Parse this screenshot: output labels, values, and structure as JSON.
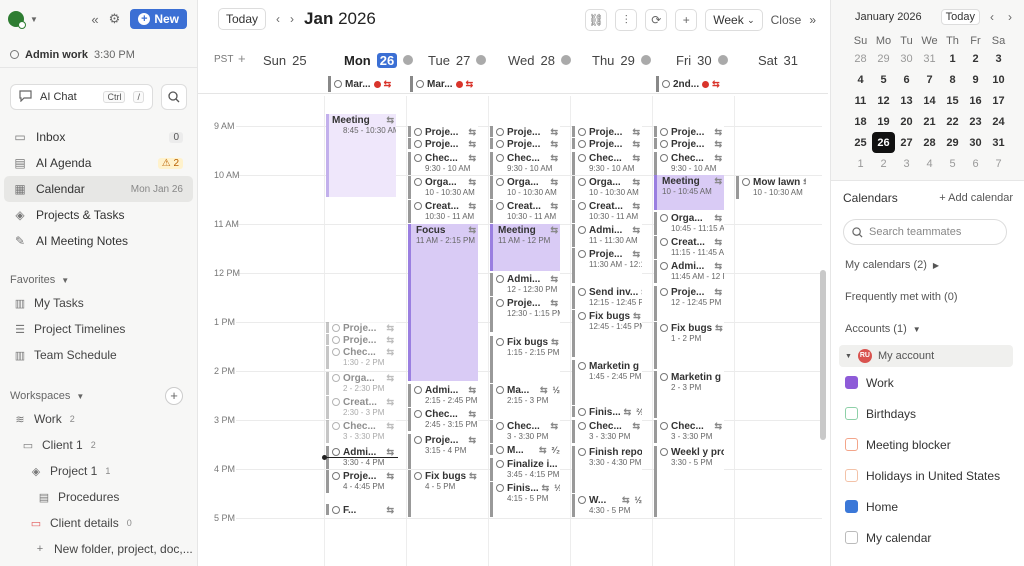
{
  "sidebar": {
    "new_label": "New",
    "current_task": {
      "title": "Admin work",
      "time": "3:30 PM"
    },
    "ai_chat": {
      "label": "AI Chat",
      "shortcut_ctrl": "Ctrl",
      "shortcut_key": "/"
    },
    "nav": [
      {
        "label": "Inbox",
        "badge": "0"
      },
      {
        "label": "AI Agenda",
        "badge": "2"
      },
      {
        "label": "Calendar",
        "date": "Mon Jan 26"
      },
      {
        "label": "Projects & Tasks"
      },
      {
        "label": "AI Meeting Notes"
      }
    ],
    "favorites": {
      "title": "Favorites",
      "items": [
        "My Tasks",
        "Project Timelines",
        "Team Schedule"
      ]
    },
    "workspaces": {
      "title": "Workspaces",
      "items": [
        {
          "label": "Work",
          "count": "2"
        },
        {
          "label": "Client 1",
          "count": "2"
        },
        {
          "label": "Project 1",
          "count": "1"
        },
        {
          "label": "Procedures"
        },
        {
          "label": "Client details",
          "count": "0"
        },
        {
          "label": "New folder, project, doc,..."
        }
      ]
    }
  },
  "toolbar": {
    "today": "Today",
    "month": "Jan",
    "year": "2026",
    "view": "Week",
    "close": "Close"
  },
  "timezone": "PST",
  "days": [
    {
      "name": "Sun",
      "num": "25"
    },
    {
      "name": "Mon",
      "num": "26"
    },
    {
      "name": "Tue",
      "num": "27"
    },
    {
      "name": "Wed",
      "num": "28"
    },
    {
      "name": "Thu",
      "num": "29"
    },
    {
      "name": "Fri",
      "num": "30"
    },
    {
      "name": "Sat",
      "num": "31"
    }
  ],
  "hours": [
    "9 AM",
    "10 AM",
    "11 AM",
    "12 PM",
    "1 PM",
    "2 PM",
    "3 PM",
    "4 PM",
    "5 PM"
  ],
  "allday": [
    "Mar...",
    "Mar...",
    "2nd..."
  ],
  "events": {
    "mon": [
      {
        "title": "Meeting",
        "time": "8:45 - 10:30 AM"
      },
      {
        "title": "Proje..."
      },
      {
        "title": "Proje..."
      },
      {
        "title": "Chec...",
        "time": "1:30 - 2 PM"
      },
      {
        "title": "Orga...",
        "time": "2 - 2:30 PM"
      },
      {
        "title": "Creat...",
        "time": "2:30 - 3 PM"
      },
      {
        "title": "Chec...",
        "time": "3 - 3:30 PM"
      },
      {
        "title": "Admi...",
        "time": "3:30 - 4 PM"
      },
      {
        "title": "Proje...",
        "time": "4 - 4:45 PM"
      },
      {
        "title": "F..."
      }
    ],
    "tue": [
      {
        "title": "Proje..."
      },
      {
        "title": "Proje..."
      },
      {
        "title": "Chec...",
        "time": "9:30 - 10 AM"
      },
      {
        "title": "Orga...",
        "time": "10 - 10:30 AM"
      },
      {
        "title": "Creat...",
        "time": "10:30 - 11 AM"
      },
      {
        "title": "Focus",
        "time": "11 AM - 2:15 PM"
      },
      {
        "title": "Admi...",
        "time": "2:15 - 2:45 PM"
      },
      {
        "title": "Chec...",
        "time": "2:45 - 3:15 PM"
      },
      {
        "title": "Proje...",
        "time": "3:15 - 4 PM"
      },
      {
        "title": "Fix bugs",
        "time": "4 - 5 PM"
      }
    ],
    "wed": [
      {
        "title": "Proje..."
      },
      {
        "title": "Proje..."
      },
      {
        "title": "Chec...",
        "time": "9:30 - 10 AM"
      },
      {
        "title": "Orga...",
        "time": "10 - 10:30 AM"
      },
      {
        "title": "Creat...",
        "time": "10:30 - 11 AM"
      },
      {
        "title": "Meeting",
        "time": "11 AM - 12 PM"
      },
      {
        "title": "Admi...",
        "time": "12 - 12:30 PM"
      },
      {
        "title": "Proje...",
        "time": "12:30 - 1:15 PM"
      },
      {
        "title": "Fix bugs",
        "time": "1:15 - 2:15 PM"
      },
      {
        "title": "Ma...",
        "time": "2:15 - 3 PM",
        "frac": "½"
      },
      {
        "title": "Chec...",
        "time": "3 - 3:30 PM"
      },
      {
        "title": "M...",
        "frac": "²⁄₂"
      },
      {
        "title": "Finalize i...",
        "time": "3:45 - 4:15 PM"
      },
      {
        "title": "Finis...",
        "time": "4:15 - 5 PM",
        "frac": "⅓"
      }
    ],
    "thu": [
      {
        "title": "Proje..."
      },
      {
        "title": "Proje..."
      },
      {
        "title": "Chec...",
        "time": "9:30 - 10 AM"
      },
      {
        "title": "Orga...",
        "time": "10 - 10:30 AM"
      },
      {
        "title": "Creat...",
        "time": "10:30 - 11 AM"
      },
      {
        "title": "Admi...",
        "time": "11 - 11:30 AM"
      },
      {
        "title": "Proje...",
        "time": "11:30 AM - 12:15 PM"
      },
      {
        "title": "Send inv...",
        "time": "12:15 - 12:45 PM"
      },
      {
        "title": "Fix bugs",
        "time": "12:45 - 1:45 PM"
      },
      {
        "title": "Marketin g",
        "time": "1:45 - 2:45 PM"
      },
      {
        "title": "Finis...",
        "frac": "⅔"
      },
      {
        "title": "Chec...",
        "time": "3 - 3:30 PM"
      },
      {
        "title": "Finish report",
        "time": "3:30 - 4:30 PM",
        "frac": "⅔"
      },
      {
        "title": "W...",
        "time": "4:30 - 5 PM",
        "frac": "½"
      }
    ],
    "fri": [
      {
        "title": "Proje..."
      },
      {
        "title": "Proje..."
      },
      {
        "title": "Chec...",
        "time": "9:30 - 10 AM"
      },
      {
        "title": "Meeting",
        "time": "10 - 10:45 AM"
      },
      {
        "title": "Orga...",
        "time": "10:45 - 11:15 AM"
      },
      {
        "title": "Creat...",
        "time": "11:15 - 11:45 AM"
      },
      {
        "title": "Admi...",
        "time": "11:45 AM - 12 PM"
      },
      {
        "title": "Proje...",
        "time": "12 - 12:45 PM"
      },
      {
        "title": "Fix bugs",
        "time": "1 - 2 PM"
      },
      {
        "title": "Marketin g",
        "time": "2 - 3 PM"
      },
      {
        "title": "Chec...",
        "time": "3 - 3:30 PM"
      },
      {
        "title": "Weekl y project",
        "time": "3:30 - 5 PM",
        "frac": "²⁄₂"
      }
    ],
    "sat": [
      {
        "title": "Mow lawn",
        "time": "10 - 10:30 AM"
      }
    ]
  },
  "mini_calendar": {
    "title": "January 2026",
    "today": "Today",
    "weekdays": [
      "Su",
      "Mo",
      "Tu",
      "We",
      "Th",
      "Fr",
      "Sa"
    ],
    "weeks": [
      [
        "28",
        "29",
        "30",
        "31",
        "1",
        "2",
        "3"
      ],
      [
        "4",
        "5",
        "6",
        "7",
        "8",
        "9",
        "10"
      ],
      [
        "11",
        "12",
        "13",
        "14",
        "15",
        "16",
        "17"
      ],
      [
        "18",
        "19",
        "20",
        "21",
        "22",
        "23",
        "24"
      ],
      [
        "25",
        "26",
        "27",
        "28",
        "29",
        "30",
        "31"
      ],
      [
        "1",
        "2",
        "3",
        "4",
        "5",
        "6",
        "7"
      ]
    ]
  },
  "calendars": {
    "title": "Calendars",
    "add": "+ Add calendar",
    "search_placeholder": "Search teammates",
    "my_calendars": "My calendars (2)",
    "frequently": "Frequently met with (0)",
    "accounts": "Accounts (1)",
    "account_initials": "RU",
    "account_name": "My account",
    "items": [
      "Work",
      "Birthdays",
      "Meeting blocker",
      "Holidays in United States",
      "Home",
      "My calendar"
    ]
  }
}
